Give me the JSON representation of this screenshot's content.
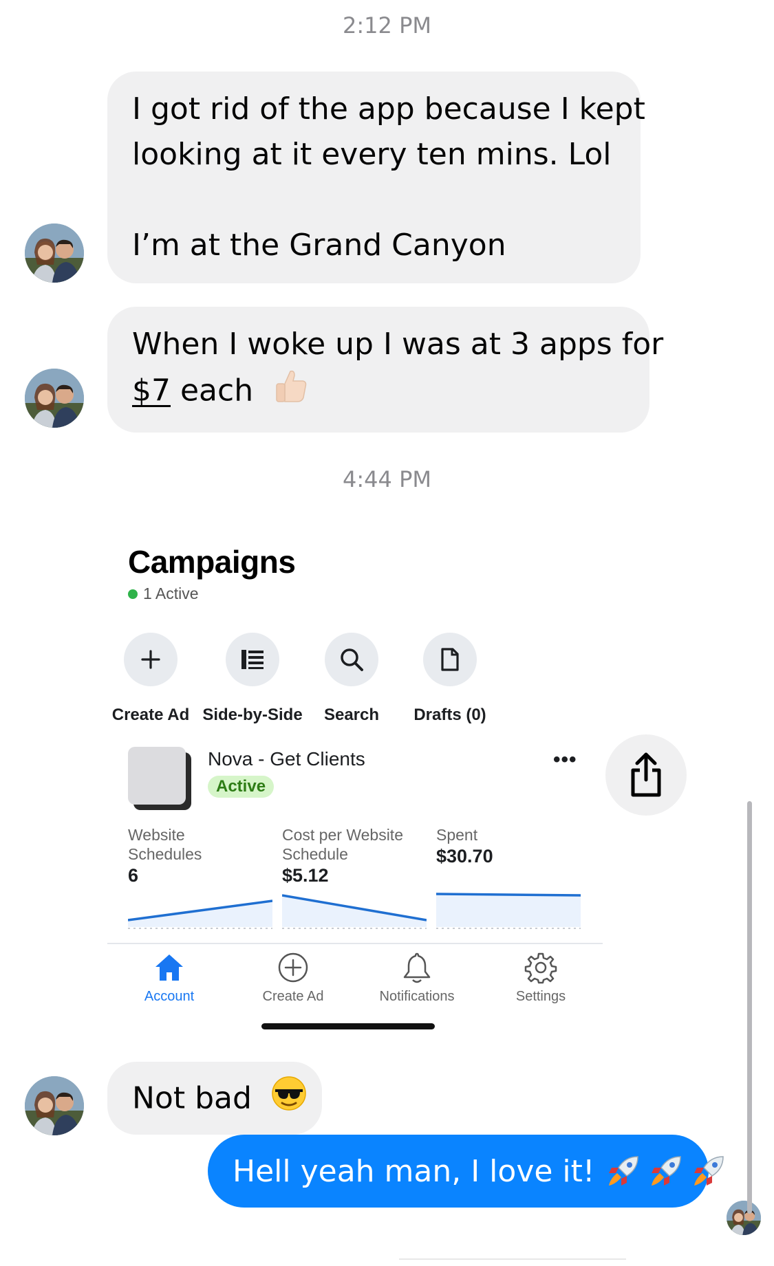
{
  "timestamps": [
    "2:12 PM",
    "4:44 PM"
  ],
  "messages": {
    "m1": {
      "line1": "I got rid of the app because I kept",
      "line2": "looking at it every ten mins. Lol",
      "line3": "I’m at the Grand Canyon"
    },
    "m2": {
      "line1": "When I woke up I was at 3 apps for",
      "price": "$7",
      "after": " each",
      "emoji": "thumbs-up-emoji"
    },
    "m3": {
      "text": "Not bad",
      "emoji": "sunglasses-emoji"
    },
    "sent": {
      "text": "Hell yeah man, I love it!",
      "emoji": "rocket-emoji",
      "emoji_count": 3
    }
  },
  "screenshot": {
    "title": "Campaigns",
    "active_count": "1 Active",
    "actions": [
      {
        "label": "Create Ad",
        "icon": "plus-icon"
      },
      {
        "label": "Side-by-Side",
        "icon": "list-icon"
      },
      {
        "label": "Search",
        "icon": "search-icon"
      },
      {
        "label": "Drafts (0)",
        "icon": "document-icon"
      }
    ],
    "ad": {
      "name": "Nova - Get Clients",
      "status": "Active",
      "more": "•••"
    },
    "metrics": [
      {
        "label_l1": "Website",
        "label_l2": "Schedules",
        "value": "6"
      },
      {
        "label_l1": "Cost per Website",
        "label_l2": "Schedule",
        "value": "$5.12"
      },
      {
        "label_l1": "Spent",
        "label_l2": "",
        "value": "$30.70"
      }
    ],
    "nav": [
      {
        "label": "Account",
        "icon": "home-icon",
        "active": true
      },
      {
        "label": "Create Ad",
        "icon": "plus-circle-icon",
        "active": false
      },
      {
        "label": "Notifications",
        "icon": "bell-icon",
        "active": false
      },
      {
        "label": "Settings",
        "icon": "gear-icon",
        "active": false
      }
    ]
  },
  "colors": {
    "incoming_bubble": "#f0f0f1",
    "outgoing_bubble": "#0a84ff",
    "accent_blue": "#1877f2",
    "active_green": "#2fb34a"
  }
}
